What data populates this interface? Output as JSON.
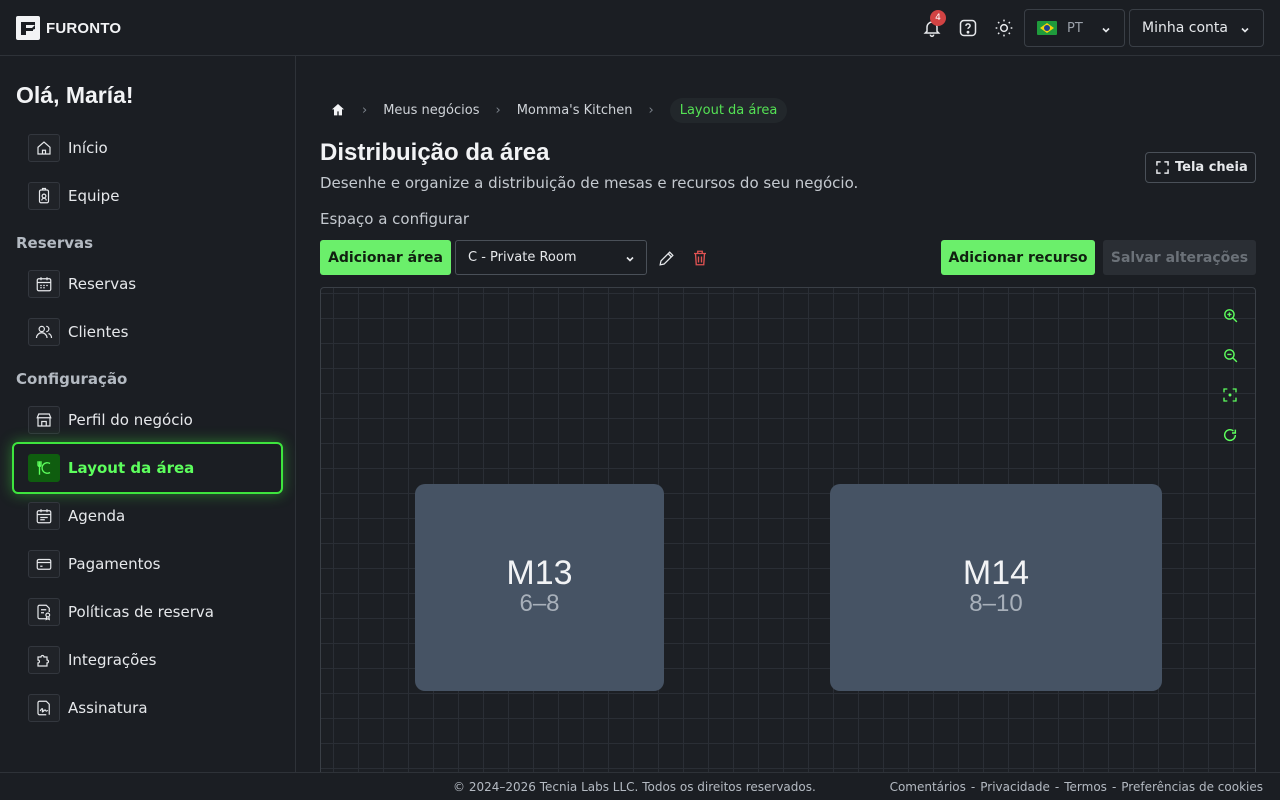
{
  "app": {
    "brand": "FURONTO"
  },
  "header": {
    "notification_count": "4",
    "language_code": "PT",
    "account_label": "Minha conta"
  },
  "sidebar": {
    "greeting": "Olá, María!",
    "items_top": [
      {
        "label": "Início",
        "icon": "home-icon"
      },
      {
        "label": "Equipe",
        "icon": "badge-icon"
      }
    ],
    "section_reservas": "Reservas",
    "items_reservas": [
      {
        "label": "Reservas",
        "icon": "calendar-icon"
      },
      {
        "label": "Clientes",
        "icon": "users-icon"
      }
    ],
    "section_config": "Configuração",
    "items_config": [
      {
        "label": "Perfil do negócio",
        "icon": "store-icon"
      },
      {
        "label": "Layout da área",
        "icon": "utensils-icon",
        "active": true
      },
      {
        "label": "Agenda",
        "icon": "schedule-icon"
      },
      {
        "label": "Pagamentos",
        "icon": "credit-card-icon"
      },
      {
        "label": "Políticas de reserva",
        "icon": "policy-icon"
      },
      {
        "label": "Integrações",
        "icon": "puzzle-icon"
      },
      {
        "label": "Assinatura",
        "icon": "signature-icon"
      }
    ]
  },
  "breadcrumb": {
    "items": [
      "Meus negócios",
      "Momma's Kitchen"
    ],
    "current": "Layout da área"
  },
  "page": {
    "title": "Distribuição da área",
    "subtitle": "Desenhe e organize a distribuição de mesas e recursos do seu negócio.",
    "fullscreen_label": "Tela cheia",
    "space_label": "Espaço a configurar",
    "add_area_label": "Adicionar área",
    "selected_area": "C - Private Room",
    "add_resource_label": "Adicionar recurso",
    "save_label": "Salvar alterações"
  },
  "tables": [
    {
      "name": "M13",
      "capacity": "6–8"
    },
    {
      "name": "M14",
      "capacity": "8–10"
    }
  ],
  "colors": {
    "accent": "#6bef6b",
    "active_text": "#5dff5d",
    "danger": "#e05252",
    "table_fill": "#465364"
  },
  "footer": {
    "copyright": "© 2024–2026 Tecnia Labs LLC. Todos os direitos reservados.",
    "links": [
      "Comentários",
      "Privacidade",
      "Termos",
      "Preferências de cookies"
    ]
  }
}
